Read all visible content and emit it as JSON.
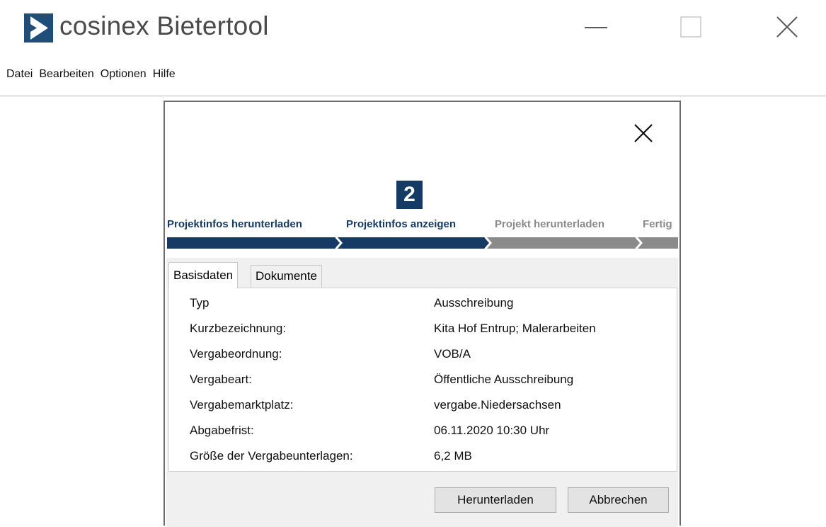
{
  "window": {
    "title": "cosinex Bietertool",
    "logo_icon": "cosinex-chevron-logo",
    "brand_color": "#1f4e79"
  },
  "menu": [
    {
      "label": "Datei"
    },
    {
      "label": "Bearbeiten"
    },
    {
      "label": "Optionen"
    },
    {
      "label": "Hilfe"
    }
  ],
  "wizard": {
    "current_step_number": "2",
    "steps": [
      {
        "label": "Projektinfos herunterladen",
        "state": "done"
      },
      {
        "label": "Projektinfos anzeigen",
        "state": "current"
      },
      {
        "label": "Projekt herunterladen",
        "state": "todo"
      },
      {
        "label": "Fertig",
        "state": "todo"
      }
    ],
    "active_color": "#153a63",
    "inactive_color": "#8a8a8a"
  },
  "tabs": [
    {
      "label": "Basisdaten",
      "active": true
    },
    {
      "label": "Dokumente",
      "active": false
    }
  ],
  "details": [
    {
      "label": "Typ",
      "value": "Ausschreibung"
    },
    {
      "label": "Kurzbezeichnung:",
      "value": "Kita Hof Entrup; Malerarbeiten"
    },
    {
      "label": "Vergabeordnung:",
      "value": "VOB/A"
    },
    {
      "label": "Vergabeart:",
      "value": "Öffentliche Ausschreibung"
    },
    {
      "label": "Vergabemarktplatz:",
      "value": "vergabe.Niedersachsen"
    },
    {
      "label": "Abgabefrist:",
      "value": "06.11.2020 10:30 Uhr"
    },
    {
      "label": "Größe der Vergabeunterlagen:",
      "value": "6,2 MB"
    }
  ],
  "buttons": {
    "download": "Herunterladen",
    "cancel": "Abbrechen"
  }
}
